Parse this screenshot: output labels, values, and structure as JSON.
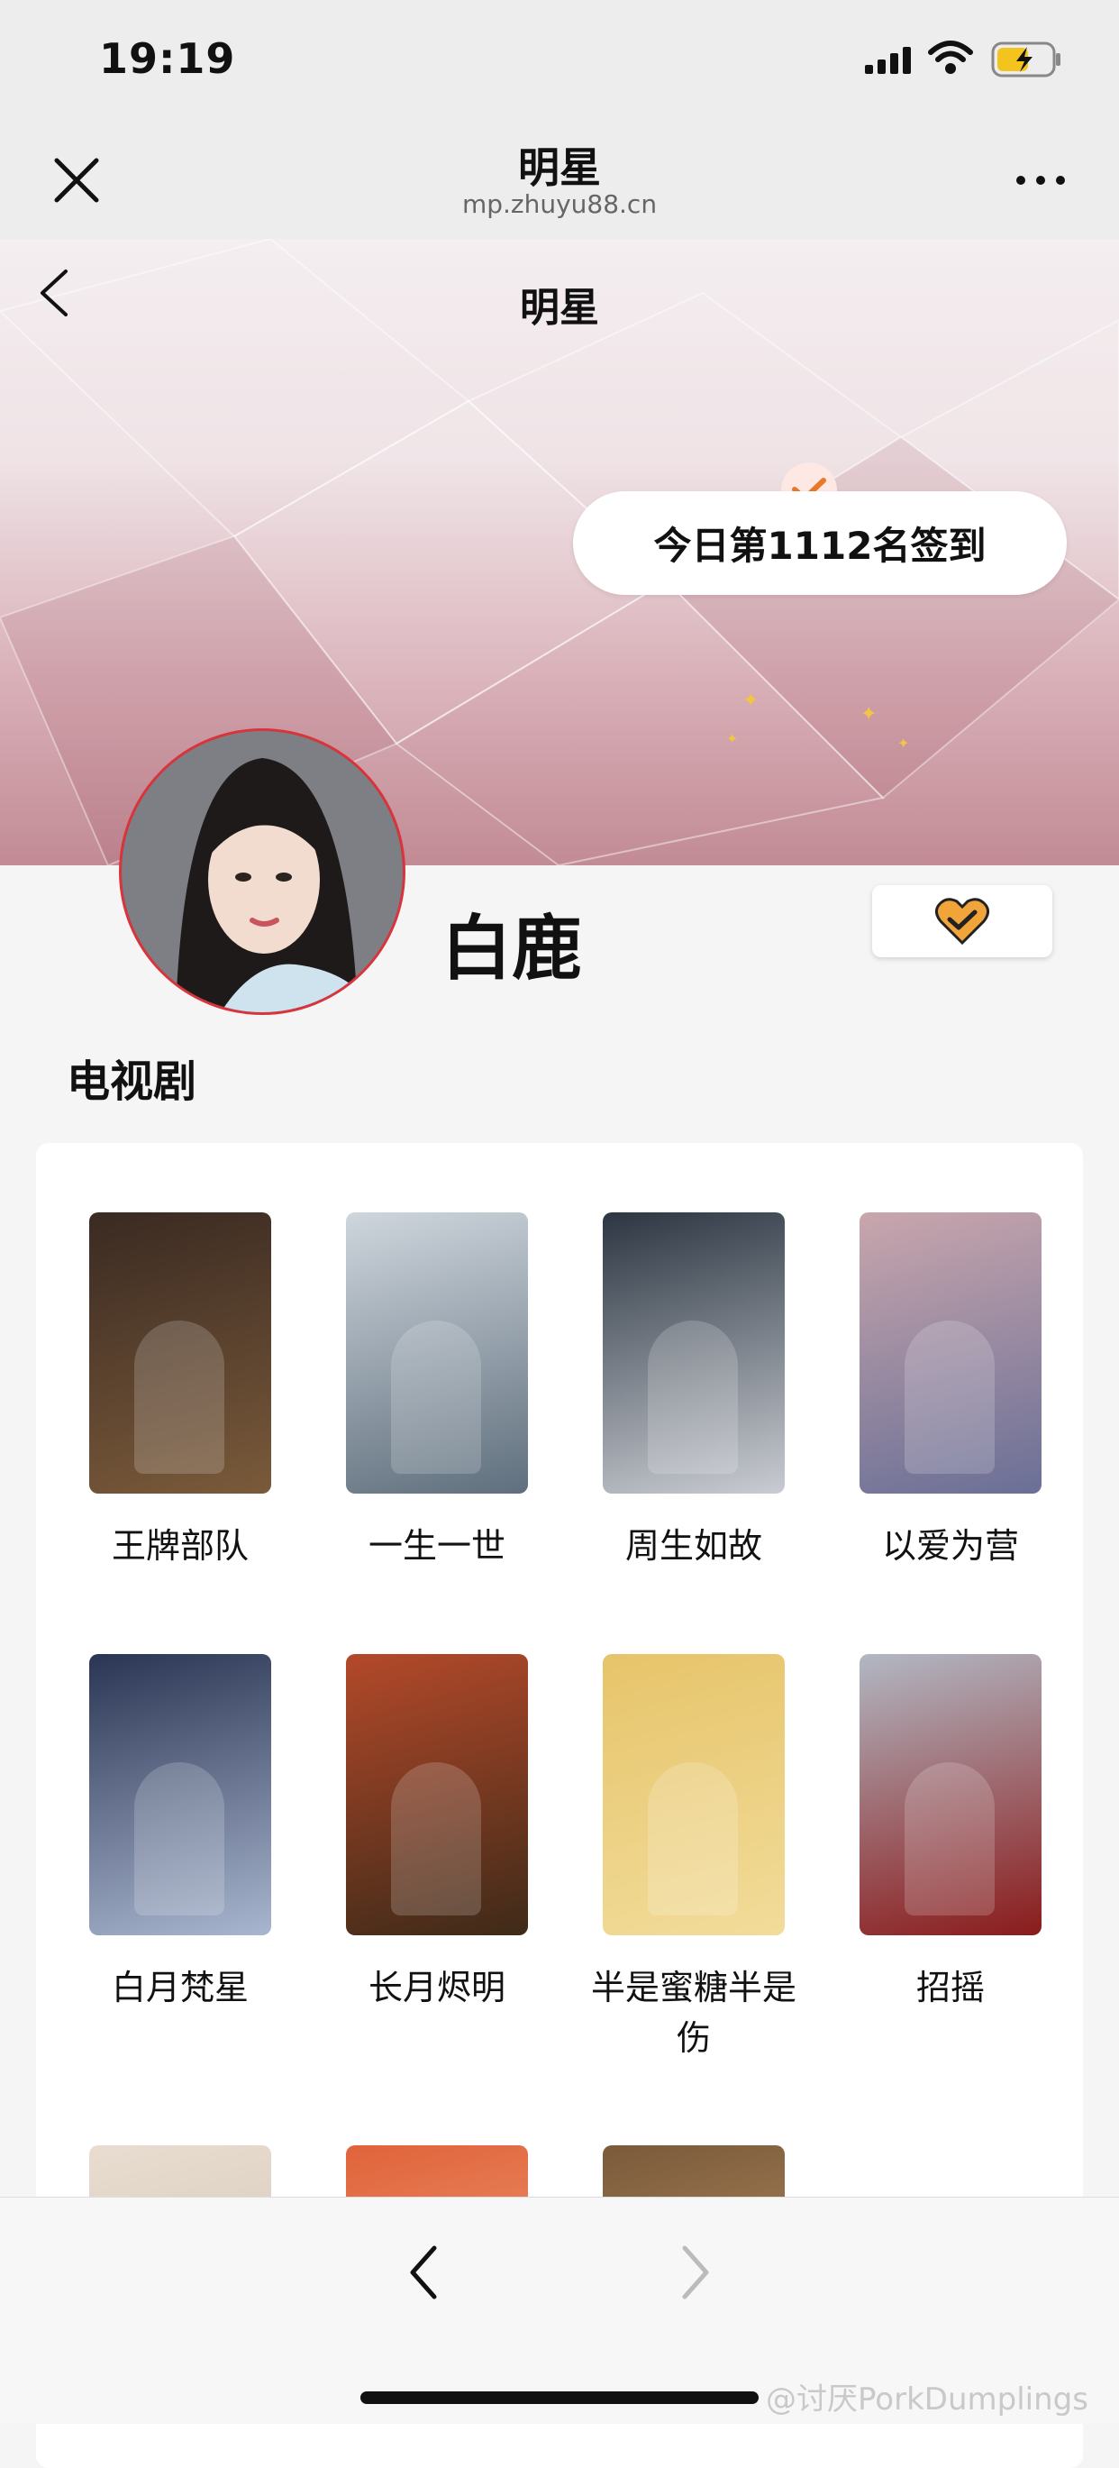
{
  "status_bar": {
    "time": "19:19"
  },
  "nav": {
    "title": "明星",
    "url": "mp.zhuyu88.cn"
  },
  "page": {
    "title": "明星"
  },
  "checkin": {
    "text": "今日第1112名签到"
  },
  "profile": {
    "name": "白鹿"
  },
  "section": {
    "title": "电视剧"
  },
  "dramas": [
    {
      "title": "王牌部队",
      "poster_colors": [
        "#3a2a22",
        "#7a5a3a"
      ]
    },
    {
      "title": "一生一世",
      "poster_colors": [
        "#cfd6dd",
        "#5f6f7d"
      ]
    },
    {
      "title": "周生如故",
      "poster_colors": [
        "#2c3642",
        "#c9ccd2"
      ]
    },
    {
      "title": "以爱为营",
      "poster_colors": [
        "#c9a6ad",
        "#6a6f96"
      ]
    },
    {
      "title": "白月梵星",
      "poster_colors": [
        "#2a3553",
        "#a9b6cf"
      ]
    },
    {
      "title": "长月烬明",
      "poster_colors": [
        "#b4492a",
        "#3e2a18"
      ]
    },
    {
      "title": "半是蜜糖半是伤",
      "poster_colors": [
        "#e6c46a",
        "#f2dc9a"
      ]
    },
    {
      "title": "招摇",
      "poster_colors": [
        "#b2b8c4",
        "#8a1b1b"
      ]
    },
    {
      "title": "",
      "poster_colors": [
        "#e8ddd0",
        "#cdbfae"
      ]
    },
    {
      "title": "",
      "poster_colors": [
        "#e0633a",
        "#f2b08a"
      ]
    },
    {
      "title": "",
      "poster_colors": [
        "#7a5a3a",
        "#c9a070"
      ]
    }
  ],
  "watermark": "@讨厌PorkDumplings",
  "colors": {
    "accent": "#d9343c",
    "heart": "#f0a43a",
    "check": "#e8782a"
  }
}
